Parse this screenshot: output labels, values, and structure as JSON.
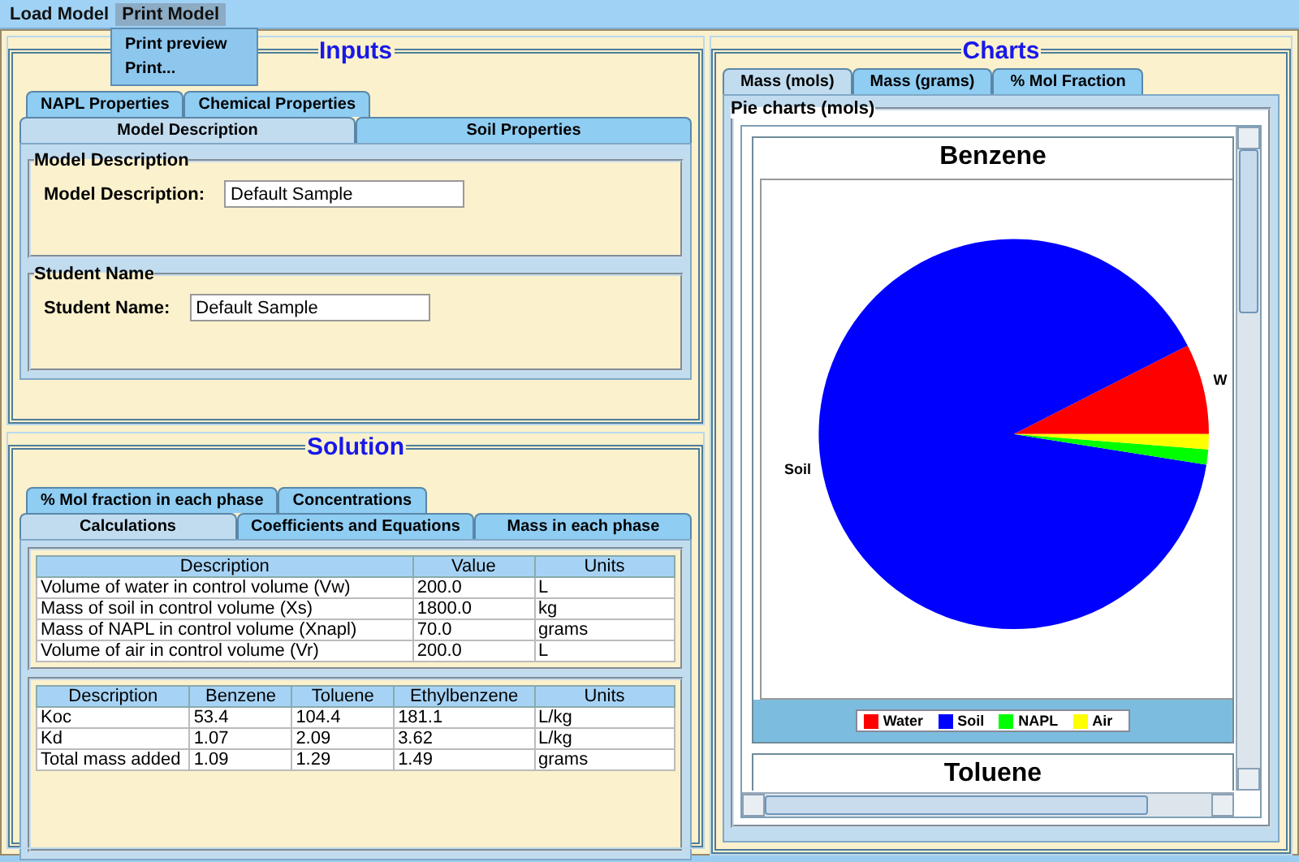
{
  "menubar": {
    "items": [
      {
        "label": "Load Model",
        "selected": false
      },
      {
        "label": "Print Model",
        "selected": true
      }
    ]
  },
  "open_menu": {
    "items": [
      {
        "label": "Print preview"
      },
      {
        "label": "Print..."
      }
    ]
  },
  "inputs": {
    "title": "Inputs",
    "tab_rows": [
      [
        {
          "label": "NAPL Properties",
          "selected": false
        },
        {
          "label": "Chemical Properties",
          "selected": false
        }
      ],
      [
        {
          "label": "Model Description",
          "selected": true
        },
        {
          "label": "Soil Properties",
          "selected": false
        }
      ]
    ],
    "groups": [
      {
        "title": "Model Description",
        "label": "Model Description:",
        "value": "Default Sample"
      },
      {
        "title": "Student Name",
        "label": "Student Name:",
        "value": "Default Sample"
      }
    ]
  },
  "solution": {
    "title": "Solution",
    "tab_rows": [
      [
        {
          "label": "% Mol fraction in each phase",
          "selected": false
        },
        {
          "label": "Concentrations",
          "selected": false
        }
      ],
      [
        {
          "label": "Calculations",
          "selected": true
        },
        {
          "label": "Coefficients and Equations",
          "selected": false
        },
        {
          "label": "Mass in each phase",
          "selected": false
        }
      ]
    ],
    "tables": [
      {
        "columns": [
          "Description",
          "Value",
          "Units"
        ],
        "rows": [
          [
            "Volume of water in control volume (Vw)",
            "200.0",
            "L"
          ],
          [
            "Mass of soil in control volume (Xs)",
            "1800.0",
            "kg"
          ],
          [
            "Mass of NAPL in control volume (Xnapl)",
            "70.0",
            "grams"
          ],
          [
            "Volume of air in control volume (Vr)",
            "200.0",
            "L"
          ]
        ]
      },
      {
        "columns": [
          "Description",
          "Benzene",
          "Toluene",
          "Ethylbenzene",
          "Units"
        ],
        "rows": [
          [
            "Koc",
            "53.4",
            "104.4",
            "181.1",
            "L/kg"
          ],
          [
            "Kd",
            "1.07",
            "2.09",
            "3.62",
            "L/kg"
          ],
          [
            "Total mass added",
            "1.09",
            "1.29",
            "1.49",
            "grams"
          ]
        ]
      }
    ]
  },
  "charts": {
    "title": "Charts",
    "tabs": [
      {
        "label": "Mass (mols)",
        "selected": true
      },
      {
        "label": "Mass (grams)",
        "selected": false
      },
      {
        "label": "% Mol Fraction",
        "selected": false
      }
    ],
    "group_title": "Pie charts (mols)",
    "chart_data": {
      "type": "pie",
      "title": "Benzene",
      "legend": "bottom",
      "categories": [
        "Water",
        "Soil",
        "NAPL",
        "Air"
      ],
      "series": [
        {
          "values": [
            7.5,
            90,
            1.25,
            1.25
          ]
        }
      ]
    },
    "slices": [
      {
        "color": "#ff0000",
        "label": "W"
      },
      {
        "color": "#0000ff",
        "label": "Soil"
      },
      {
        "color": "#00ff00"
      },
      {
        "color": "#ffff00"
      }
    ],
    "next_chart_title": "Toluene"
  }
}
